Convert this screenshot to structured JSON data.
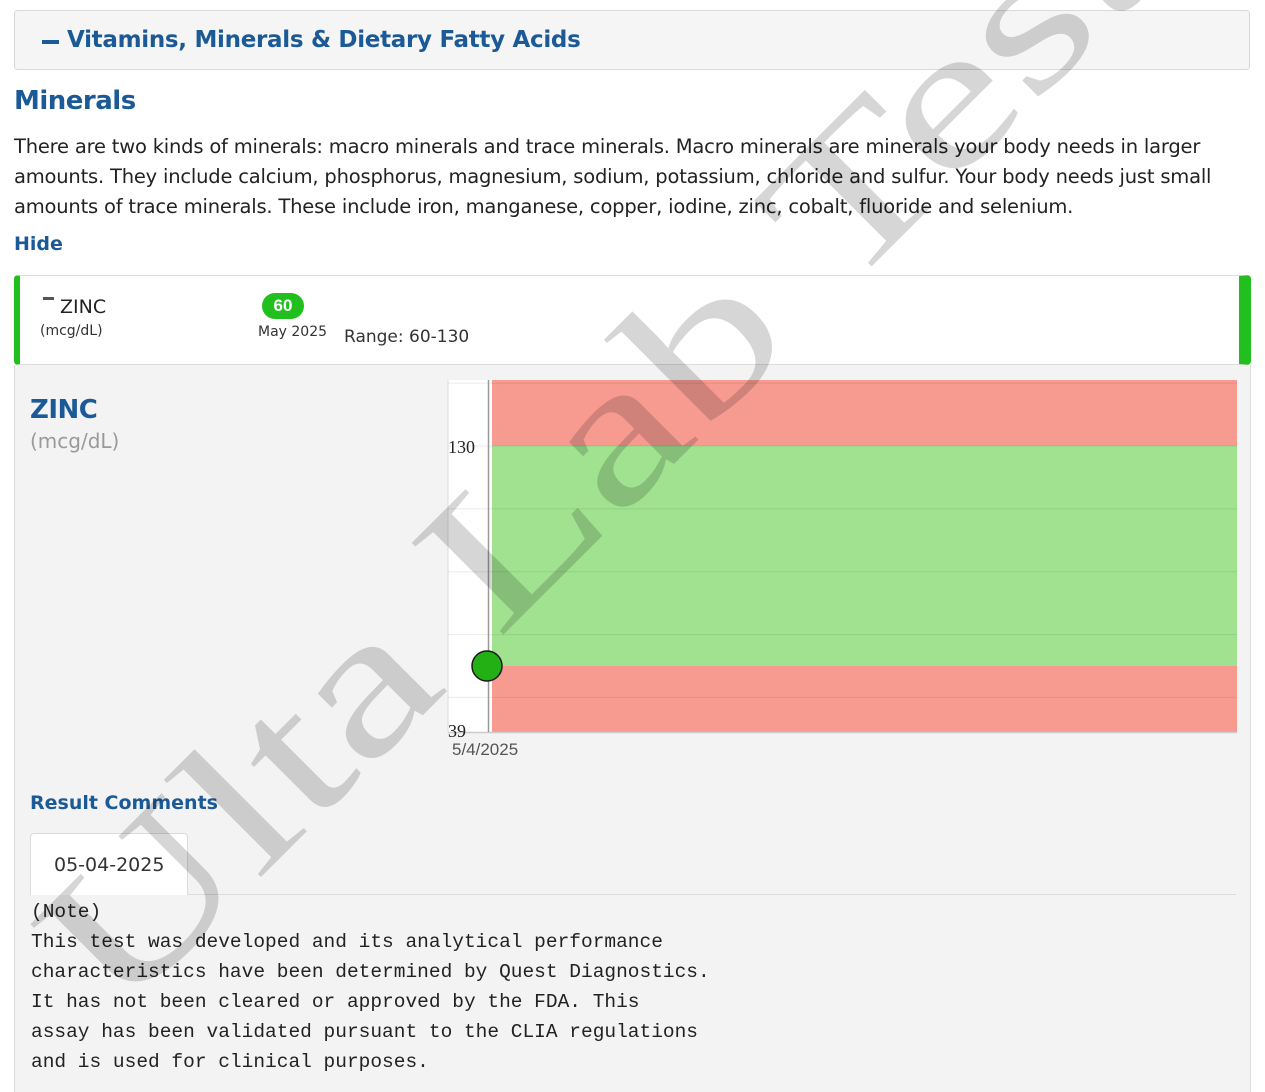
{
  "section": {
    "title": "Vitamins, Minerals & Dietary Fatty Acids"
  },
  "minerals": {
    "heading": "Minerals",
    "description": "There are two kinds of minerals: macro minerals and trace minerals. Macro minerals are minerals your body needs in larger amounts. They include calcium, phosphorus, magnesium, sodium, potassium, chloride and sulfur. Your body needs just small amounts of trace minerals. These include iron, manganese, copper, iodine, zinc, cobalt, fluoride and selenium.",
    "hide_label": "Hide"
  },
  "test": {
    "name": "ZINC",
    "unit": "(mcg/dL)",
    "value": "60",
    "date": "May 2025",
    "range": "Range: 60-130",
    "status_color": "#22c01e"
  },
  "detail": {
    "title": "ZINC",
    "unit": "(mcg/dL)"
  },
  "chart_data": {
    "type": "scatter",
    "x": [
      "5/4/2025"
    ],
    "y": [
      60
    ],
    "y_tick_labels": [
      "130",
      "39"
    ],
    "ylim": [
      39,
      151
    ],
    "reference_range": [
      60,
      130
    ],
    "colors": {
      "normal": "#a0e290",
      "abnormal": "#f79b91",
      "point": "#22b014"
    },
    "grid": true
  },
  "comments": {
    "title": "Result Comments",
    "tab_label": "05-04-2025",
    "text": "(Note)\nThis test was developed and its analytical performance\ncharacteristics have been determined by Quest Diagnostics.\nIt has not been cleared or approved by the FDA. This\nassay has been validated pursuant to the CLIA regulations\nand is used for clinical purposes."
  },
  "watermark": {
    "text": "Ulta Lab Tests"
  }
}
